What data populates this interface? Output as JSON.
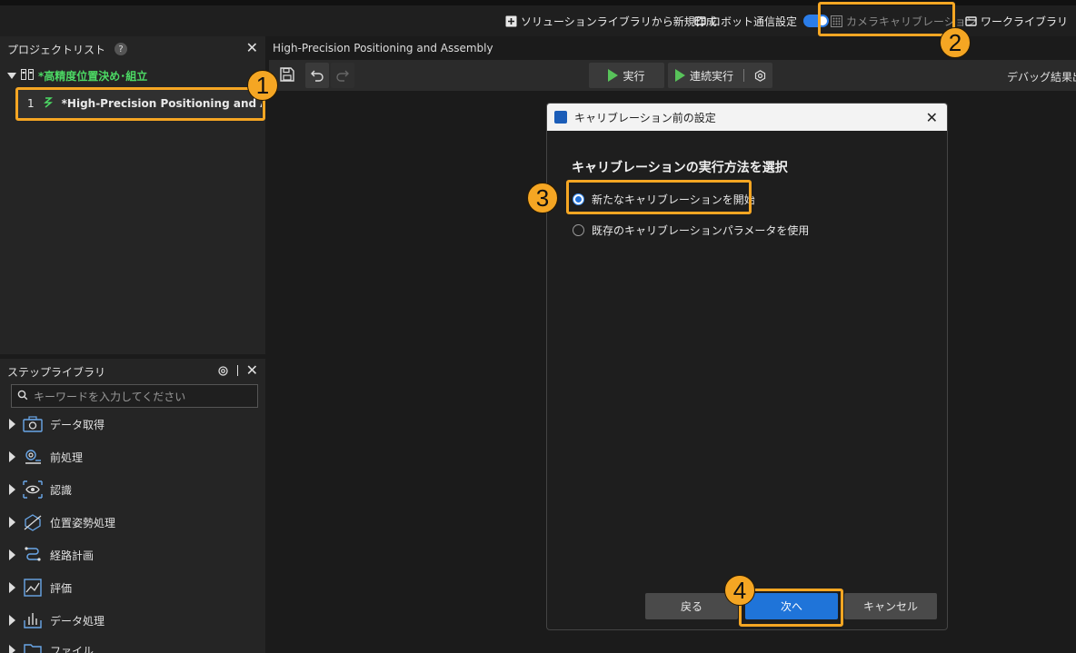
{
  "topbar": {
    "new_from_library": "ソリューションライブラリから新規作成",
    "robot_comm": "ロボット通信設定",
    "camera_calibration": "カメラキャリブレーション",
    "work_library": "ワークライブラリ"
  },
  "project_list": {
    "title": "プロジェクトリスト",
    "help": "?",
    "group_name": "*高精度位置決め･組立",
    "item_index": "1",
    "item_name": "*High-Precision Positioning and Asse..."
  },
  "step_library": {
    "title": "ステップライブラリ",
    "search_placeholder": "キーワードを入力してください",
    "items": [
      {
        "label": "データ取得",
        "icon": "camera-icon"
      },
      {
        "label": "前処理",
        "icon": "gear-preprocess-icon"
      },
      {
        "label": "認識",
        "icon": "eye-icon"
      },
      {
        "label": "位置姿勢処理",
        "icon": "pose-icon"
      },
      {
        "label": "経路計画",
        "icon": "path-icon"
      },
      {
        "label": "評価",
        "icon": "chart-icon"
      },
      {
        "label": "データ処理",
        "icon": "data-icon"
      },
      {
        "label": "ファイル",
        "icon": "folder-icon"
      }
    ]
  },
  "main": {
    "tab_title": "High-Precision Positioning and Assembly",
    "run": "実行",
    "continuous_run": "連続実行",
    "debug_output": "デバッグ結果出力"
  },
  "dialog": {
    "title": "キャリブレーション前の設定",
    "heading": "キャリブレーションの実行方法を選択",
    "option_new": "新たなキャリブレーションを開始",
    "option_existing": "既存のキャリブレーションパラメータを使用",
    "back": "戻る",
    "next": "次へ",
    "cancel": "キャンセル"
  },
  "badges": [
    "1",
    "2",
    "3",
    "4"
  ],
  "colors": {
    "accent": "#f5a623",
    "primary": "#1f74d9",
    "group_green": "#4cd964",
    "play_green": "#58c35a"
  }
}
